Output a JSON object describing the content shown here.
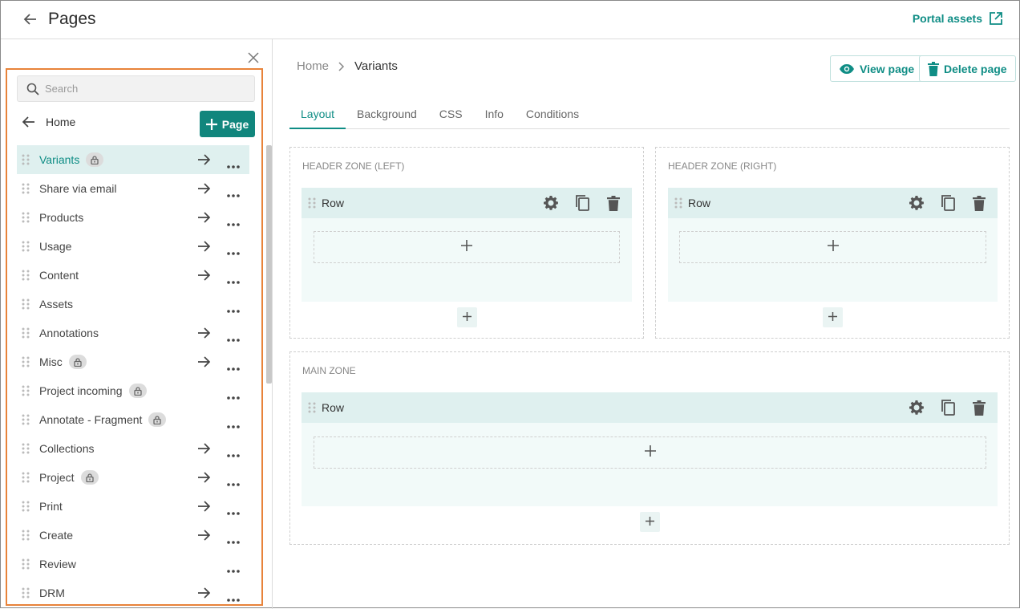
{
  "header": {
    "title": "Pages",
    "portal_assets_label": "Portal assets"
  },
  "sidebar": {
    "search_placeholder": "Search",
    "home_label": "Home",
    "add_page_label": "Page",
    "items": [
      {
        "label": "Variants",
        "locked": true,
        "arrow": true,
        "active": true
      },
      {
        "label": "Share via email",
        "locked": false,
        "arrow": true
      },
      {
        "label": "Products",
        "locked": false,
        "arrow": true
      },
      {
        "label": "Usage",
        "locked": false,
        "arrow": true
      },
      {
        "label": "Content",
        "locked": false,
        "arrow": true
      },
      {
        "label": "Assets",
        "locked": false,
        "arrow": false
      },
      {
        "label": "Annotations",
        "locked": false,
        "arrow": true
      },
      {
        "label": "Misc",
        "locked": true,
        "arrow": true
      },
      {
        "label": "Project incoming",
        "locked": true,
        "arrow": false
      },
      {
        "label": "Annotate - Fragment",
        "locked": true,
        "arrow": false
      },
      {
        "label": "Collections",
        "locked": false,
        "arrow": true
      },
      {
        "label": "Project",
        "locked": true,
        "arrow": true
      },
      {
        "label": "Print",
        "locked": false,
        "arrow": true
      },
      {
        "label": "Create",
        "locked": false,
        "arrow": true
      },
      {
        "label": "Review",
        "locked": false,
        "arrow": false
      },
      {
        "label": "DRM",
        "locked": false,
        "arrow": true
      }
    ]
  },
  "main": {
    "breadcrumb": {
      "home": "Home",
      "current": "Variants"
    },
    "view_page_label": "View page",
    "delete_page_label": "Delete page",
    "tabs": [
      "Layout",
      "Background",
      "CSS",
      "Info",
      "Conditions"
    ],
    "zones": {
      "header_left": {
        "label": "HEADER ZONE (LEFT)",
        "row_label": "Row"
      },
      "header_right": {
        "label": "HEADER ZONE (RIGHT)",
        "row_label": "Row"
      },
      "main": {
        "label": "MAIN ZONE",
        "row_label": "Row"
      }
    },
    "add_symbol": "+"
  },
  "colors": {
    "accent": "#11867d",
    "highlight_border": "#e8833a",
    "row_header": "#dff0ef"
  }
}
